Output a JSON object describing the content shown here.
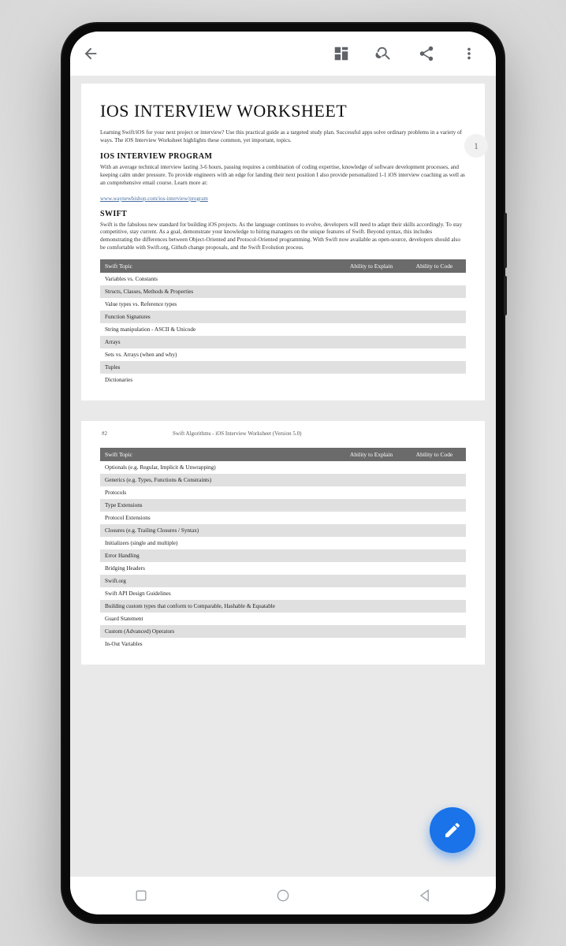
{
  "toolbar": {
    "back": "back",
    "format": "layout",
    "search": "search",
    "share": "share",
    "more": "more"
  },
  "page_badge": "1",
  "doc": {
    "title": "IOS INTERVIEW WORKSHEET",
    "intro": "Learning Swift/iOS for your next project or interview? Use this practical guide as a targeted study plan. Successful apps solve ordinary problems in a variety of ways. The iOS Interview Worksheet highlights these common, yet important, topics.",
    "section1_heading": "IOS INTERVIEW PROGRAM",
    "section1_body": "With an average technical interview lasting 3-6 hours, passing requires a combination of coding expertise, knowledge of software development processes, and keeping calm under pressure. To provide engineers with an edge for landing their next position I also provide personalized 1-1 iOS interview coaching as well as an comprehensive email course. Learn more at:",
    "link": "www.waynewbishop.com/ios-interview/program",
    "section2_heading": "SWIFT",
    "section2_body": "Swift is the fabulous new standard for building iOS projects.  As the language continues to evolve, developers will need to adapt their skills accordingly.  To stay competitive, stay current. As a goal, demonstrate your knowledge to hiring managers on the unique features of Swift. Beyond syntax, this includes demonstrating the differences between Object-Oriented and Protocol-Oriented programming. With Swift now available as open-source, developers should also be comfortable with Swift.org, Github change proposals, and the Swift Evolution process.",
    "table_headers": [
      "Swift Topic",
      "Ability to Explain",
      "Ability to Code"
    ],
    "table1_rows": [
      "Variables vs. Constants",
      "Structs, Classes, Methods & Properties",
      "Value types vs. Reference types",
      "Function Signatures",
      "String manipulation - ASCII & Unicode",
      "Arrays",
      "Sets vs. Arrays (when and why)",
      "Tuples",
      "Dictionaries"
    ],
    "page2_number": "#2",
    "page2_running": "Swift Algorithms - iOS Interview Worksheet (Version 5.0)",
    "table2_rows": [
      "Optionals (e.g. Regular, Implicit & Unwrapping)",
      "Generics (e.g. Types, Functions & Constraints)",
      "Protocols",
      "Type Extensions",
      "Protocol Extensions",
      "Closures (e.g. Trailing Closures / Syntax)",
      "Initializers (single and multiple)",
      "Error Handling",
      "Bridging Headers",
      "Swift.org",
      "Swift API Design Guidelines",
      "Building custom types that conform to Comparable, Hashable & Equatable",
      "Guard Statement",
      "Custom (Advanced) Operators",
      "In-Out Variables"
    ]
  },
  "fab": "edit",
  "nav": {
    "recents": "recents",
    "home": "home",
    "back": "back"
  }
}
